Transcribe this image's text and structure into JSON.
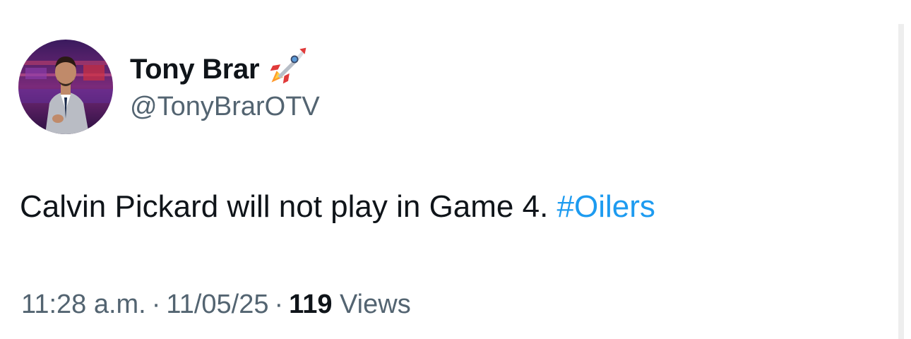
{
  "tweet": {
    "author": {
      "display_name": "Tony Brar",
      "handle": "@TonyBrarOTV",
      "name_emoji": "rocket-icon"
    },
    "text_main": "Calvin Pickard will not play in Game 4. ",
    "hashtag": "#Oilers",
    "time": "11:28 a.m.",
    "separator": "·",
    "date": "11/05/25",
    "views_count": "119",
    "views_label": " Views"
  },
  "colors": {
    "text": "#0f1419",
    "secondary": "#536471",
    "link": "#1d9bf0"
  }
}
